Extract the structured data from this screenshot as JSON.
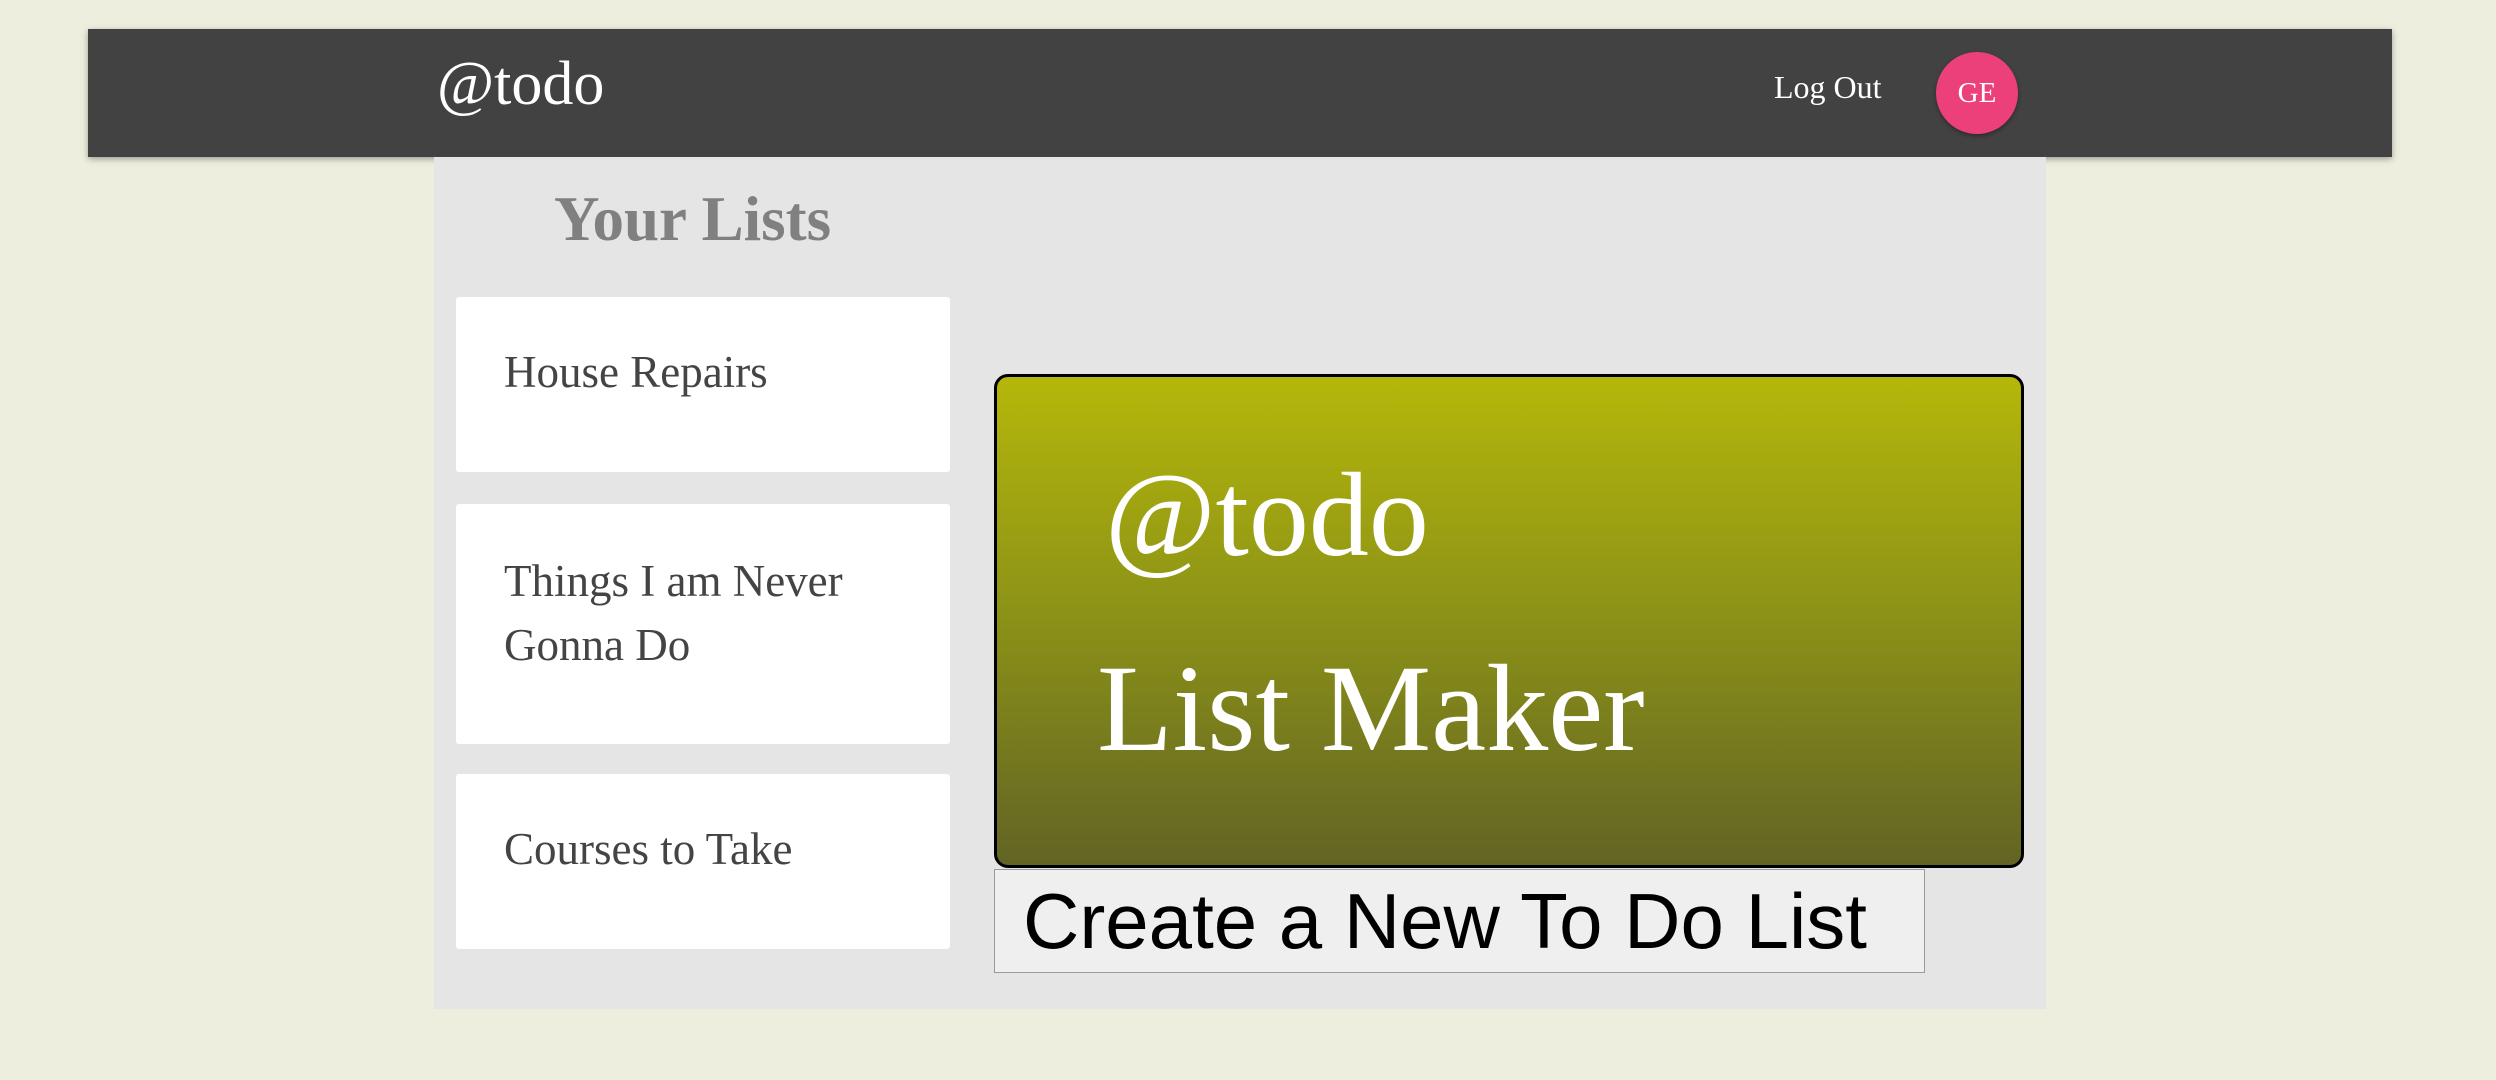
{
  "header": {
    "brand": "@todo",
    "logout_label": "Log Out",
    "avatar_initials": "GE",
    "avatar_color": "#ec407a",
    "background_color": "#424242"
  },
  "lists_panel": {
    "heading": "Your Lists",
    "items": [
      {
        "label": "House Repairs"
      },
      {
        "label": "Things I am Never Gonna Do"
      },
      {
        "label": "Courses to Take"
      }
    ]
  },
  "banner": {
    "brand": "@todo",
    "title": "List Maker",
    "gradient_top": "#b5b70a",
    "gradient_bottom": "#626424"
  },
  "actions": {
    "create_label": "Create a New To Do List"
  }
}
